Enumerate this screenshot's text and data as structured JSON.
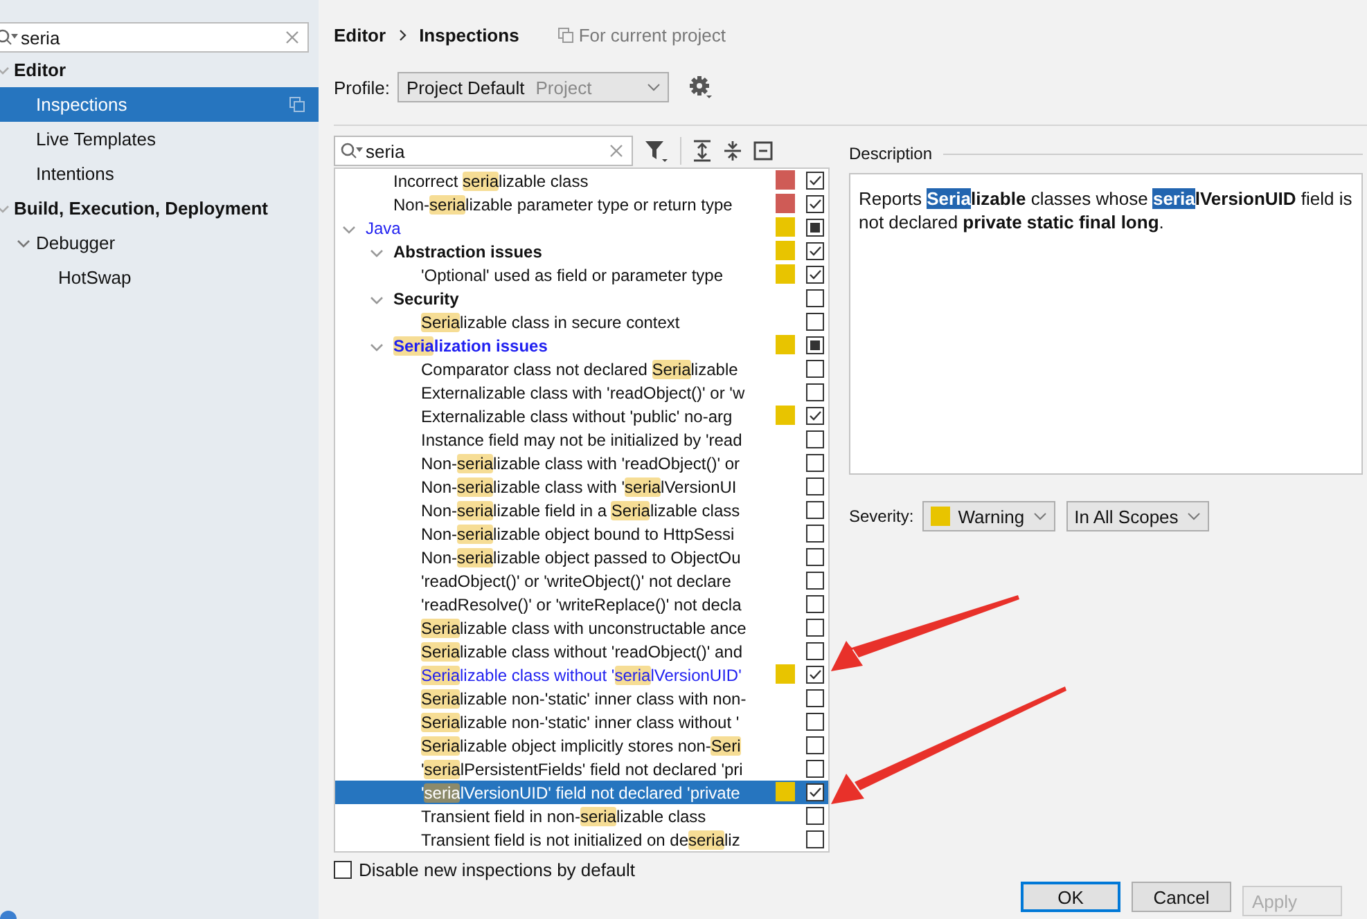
{
  "sidebar": {
    "search": {
      "value": "seria"
    },
    "items": [
      {
        "label": "Editor",
        "expanded": true,
        "selected": false,
        "project_scope": false,
        "children": [
          {
            "label": "Inspections",
            "selected": true,
            "project_scope": true
          },
          {
            "label": "Live Templates",
            "selected": false,
            "project_scope": false
          },
          {
            "label": "Intentions",
            "selected": false,
            "project_scope": false
          }
        ]
      },
      {
        "label": "Build, Execution, Deployment",
        "expanded": true,
        "selected": false,
        "project_scope": false,
        "children": [
          {
            "label": "Debugger",
            "expanded": true,
            "selected": false,
            "project_scope": false,
            "children": [
              {
                "label": "HotSwap",
                "selected": false,
                "project_scope": false
              }
            ]
          }
        ]
      }
    ]
  },
  "breadcrumb": [
    "Editor",
    "Inspections"
  ],
  "scope_note": "For current project",
  "profile": {
    "label": "Profile:",
    "value": "Project Default",
    "scope": "Project"
  },
  "filter": {
    "value": "seria"
  },
  "tree": [
    {
      "children": [
        {
          "kind": "inspection",
          "parts": [
            {
              "text": "Incorrect ",
              "match": false
            },
            {
              "text": "seria",
              "match": true
            },
            {
              "text": "lizable class",
              "match": false
            }
          ],
          "color": "#cf5b56",
          "checked": true,
          "partial": false,
          "modified": false,
          "selected": false
        },
        {
          "kind": "inspection",
          "parts": [
            {
              "text": "Non-",
              "match": false
            },
            {
              "text": "seria",
              "match": true
            },
            {
              "text": "lizable parameter type or return type",
              "match": false
            }
          ],
          "color": "#cf5b56",
          "checked": true,
          "partial": false,
          "modified": false,
          "selected": false
        }
      ]
    },
    {
      "kind": "group",
      "parts": [
        {
          "text": "Java",
          "match": false
        }
      ],
      "expanded": true,
      "color": "#e8c400",
      "partial": true,
      "modified": true,
      "selected": false,
      "children": [
        {
          "kind": "group",
          "parts": [
            {
              "text": "Abstraction issues",
              "match": false
            }
          ],
          "expanded": true,
          "color": "#e8c400",
          "checked": true,
          "partial": false,
          "modified": false,
          "selected": false,
          "children": [
            {
              "kind": "inspection",
              "parts": [
                {
                  "text": "'Optional' used as field or parameter type",
                  "match": false
                }
              ],
              "color": "#e8c400",
              "checked": true,
              "partial": false,
              "modified": false,
              "selected": false
            }
          ]
        },
        {
          "kind": "group",
          "parts": [
            {
              "text": "Security",
              "match": false
            }
          ],
          "expanded": true,
          "checked": false,
          "partial": false,
          "modified": false,
          "selected": false,
          "children": [
            {
              "kind": "inspection",
              "parts": [
                {
                  "text": "Seria",
                  "match": true
                },
                {
                  "text": "lizable class in secure context",
                  "match": false
                }
              ],
              "checked": false,
              "partial": false,
              "modified": false,
              "selected": false
            }
          ]
        },
        {
          "kind": "group",
          "parts": [
            {
              "text": "Seria",
              "match": true
            },
            {
              "text": "lization issues",
              "match": false
            }
          ],
          "expanded": true,
          "color": "#e8c400",
          "partial": true,
          "modified": true,
          "selected": false,
          "children": [
            {
              "kind": "inspection",
              "parts": [
                {
                  "text": "Comparator class not declared ",
                  "match": false
                },
                {
                  "text": "Seria",
                  "match": true
                },
                {
                  "text": "lizable",
                  "match": false
                }
              ],
              "checked": false,
              "partial": false,
              "modified": false,
              "selected": false
            },
            {
              "kind": "inspection",
              "parts": [
                {
                  "text": "Externalizable class with 'readObject()' or 'w",
                  "match": false
                }
              ],
              "checked": false,
              "partial": false,
              "modified": false,
              "selected": false
            },
            {
              "kind": "inspection",
              "parts": [
                {
                  "text": "Externalizable class without 'public' no-arg",
                  "match": false
                }
              ],
              "color": "#e8c400",
              "checked": true,
              "partial": false,
              "modified": false,
              "selected": false
            },
            {
              "kind": "inspection",
              "parts": [
                {
                  "text": "Instance field may not be initialized by 'read",
                  "match": false
                }
              ],
              "checked": false,
              "partial": false,
              "modified": false,
              "selected": false
            },
            {
              "kind": "inspection",
              "parts": [
                {
                  "text": "Non-",
                  "match": false
                },
                {
                  "text": "seria",
                  "match": true
                },
                {
                  "text": "lizable class with 'readObject()' or",
                  "match": false
                }
              ],
              "checked": false,
              "partial": false,
              "modified": false,
              "selected": false
            },
            {
              "kind": "inspection",
              "parts": [
                {
                  "text": "Non-",
                  "match": false
                },
                {
                  "text": "seria",
                  "match": true
                },
                {
                  "text": "lizable class with '",
                  "match": false
                },
                {
                  "text": "seria",
                  "match": true
                },
                {
                  "text": "lVersionUI",
                  "match": false
                }
              ],
              "checked": false,
              "partial": false,
              "modified": false,
              "selected": false
            },
            {
              "kind": "inspection",
              "parts": [
                {
                  "text": "Non-",
                  "match": false
                },
                {
                  "text": "seria",
                  "match": true
                },
                {
                  "text": "lizable field in a ",
                  "match": false
                },
                {
                  "text": "Seria",
                  "match": true
                },
                {
                  "text": "lizable class",
                  "match": false
                }
              ],
              "checked": false,
              "partial": false,
              "modified": false,
              "selected": false
            },
            {
              "kind": "inspection",
              "parts": [
                {
                  "text": "Non-",
                  "match": false
                },
                {
                  "text": "seria",
                  "match": true
                },
                {
                  "text": "lizable object bound to HttpSessi",
                  "match": false
                }
              ],
              "checked": false,
              "partial": false,
              "modified": false,
              "selected": false
            },
            {
              "kind": "inspection",
              "parts": [
                {
                  "text": "Non-",
                  "match": false
                },
                {
                  "text": "seria",
                  "match": true
                },
                {
                  "text": "lizable object passed to ObjectOu",
                  "match": false
                }
              ],
              "checked": false,
              "partial": false,
              "modified": false,
              "selected": false
            },
            {
              "kind": "inspection",
              "parts": [
                {
                  "text": "'readObject()' or 'writeObject()' not declare",
                  "match": false
                }
              ],
              "checked": false,
              "partial": false,
              "modified": false,
              "selected": false
            },
            {
              "kind": "inspection",
              "parts": [
                {
                  "text": "'readResolve()' or 'writeReplace()' not decla",
                  "match": false
                }
              ],
              "checked": false,
              "partial": false,
              "modified": false,
              "selected": false
            },
            {
              "kind": "inspection",
              "parts": [
                {
                  "text": "Seria",
                  "match": true
                },
                {
                  "text": "lizable class with unconstructable ance",
                  "match": false
                }
              ],
              "checked": false,
              "partial": false,
              "modified": false,
              "selected": false
            },
            {
              "kind": "inspection",
              "parts": [
                {
                  "text": "Seria",
                  "match": true
                },
                {
                  "text": "lizable class without 'readObject()' and",
                  "match": false
                }
              ],
              "checked": false,
              "partial": false,
              "modified": false,
              "selected": false
            },
            {
              "kind": "inspection",
              "parts": [
                {
                  "text": "Seria",
                  "match": true
                },
                {
                  "text": "lizable class without '",
                  "match": false
                },
                {
                  "text": "seria",
                  "match": true
                },
                {
                  "text": "lVersionUID'",
                  "match": false
                }
              ],
              "color": "#e8c400",
              "checked": true,
              "partial": false,
              "modified": true,
              "selected": false
            },
            {
              "kind": "inspection",
              "parts": [
                {
                  "text": "Seria",
                  "match": true
                },
                {
                  "text": "lizable non-'static' inner class with non-",
                  "match": false
                }
              ],
              "checked": false,
              "partial": false,
              "modified": false,
              "selected": false
            },
            {
              "kind": "inspection",
              "parts": [
                {
                  "text": "Seria",
                  "match": true
                },
                {
                  "text": "lizable non-'static' inner class without '",
                  "match": false
                }
              ],
              "checked": false,
              "partial": false,
              "modified": false,
              "selected": false
            },
            {
              "kind": "inspection",
              "parts": [
                {
                  "text": "Seria",
                  "match": true
                },
                {
                  "text": "lizable object implicitly stores non-",
                  "match": false
                },
                {
                  "text": "Seri",
                  "match": true
                }
              ],
              "checked": false,
              "partial": false,
              "modified": false,
              "selected": false
            },
            {
              "kind": "inspection",
              "parts": [
                {
                  "text": "'",
                  "match": false
                },
                {
                  "text": "seria",
                  "match": true
                },
                {
                  "text": "lPersistentFields' field not declared 'pri",
                  "match": false
                }
              ],
              "checked": false,
              "partial": false,
              "modified": false,
              "selected": false
            },
            {
              "kind": "inspection",
              "parts": [
                {
                  "text": "'",
                  "match": false
                },
                {
                  "text": "seria",
                  "match": true
                },
                {
                  "text": "lVersionUID' field not declared 'private",
                  "match": false
                }
              ],
              "color": "#e8c400",
              "checked": true,
              "partial": false,
              "modified": false,
              "selected": true
            },
            {
              "kind": "inspection",
              "parts": [
                {
                  "text": "Transient field in non-",
                  "match": false
                },
                {
                  "text": "seria",
                  "match": true
                },
                {
                  "text": "lizable class",
                  "match": false
                }
              ],
              "checked": false,
              "partial": false,
              "modified": false,
              "selected": false
            },
            {
              "kind": "inspection",
              "parts": [
                {
                  "text": "Transient field is not initialized on de",
                  "match": false
                },
                {
                  "text": "seria",
                  "match": true
                },
                {
                  "text": "liz",
                  "match": false
                }
              ],
              "checked": false,
              "partial": false,
              "modified": false,
              "selected": false
            }
          ]
        }
      ]
    }
  ],
  "disable_new": {
    "label": "Disable new inspections by default",
    "checked": false
  },
  "description": {
    "title": "Description",
    "parts": [
      {
        "text": "Reports ",
        "bold": false,
        "match": false
      },
      {
        "text": "Seria",
        "bold": true,
        "match": true
      },
      {
        "text": "lizable",
        "bold": true,
        "match": false
      },
      {
        "text": " classes whose ",
        "bold": false,
        "match": false
      },
      {
        "text": "seria",
        "bold": true,
        "match": true
      },
      {
        "text": "lVersionUID",
        "bold": true,
        "match": false
      },
      {
        "text": " field is not declared ",
        "bold": false,
        "match": false
      },
      {
        "text": "private static final long",
        "bold": true,
        "match": false
      },
      {
        "text": ".",
        "bold": false,
        "match": false
      }
    ]
  },
  "severity": {
    "label": "Severity:",
    "value": "Warning",
    "color": "#e8c400",
    "scope": "In All Scopes"
  },
  "buttons": [
    {
      "label": "OK",
      "kind": "default",
      "disabled": false
    },
    {
      "label": "Cancel",
      "kind": "normal",
      "disabled": false
    },
    {
      "label": "Apply",
      "kind": "normal",
      "disabled": true
    }
  ]
}
